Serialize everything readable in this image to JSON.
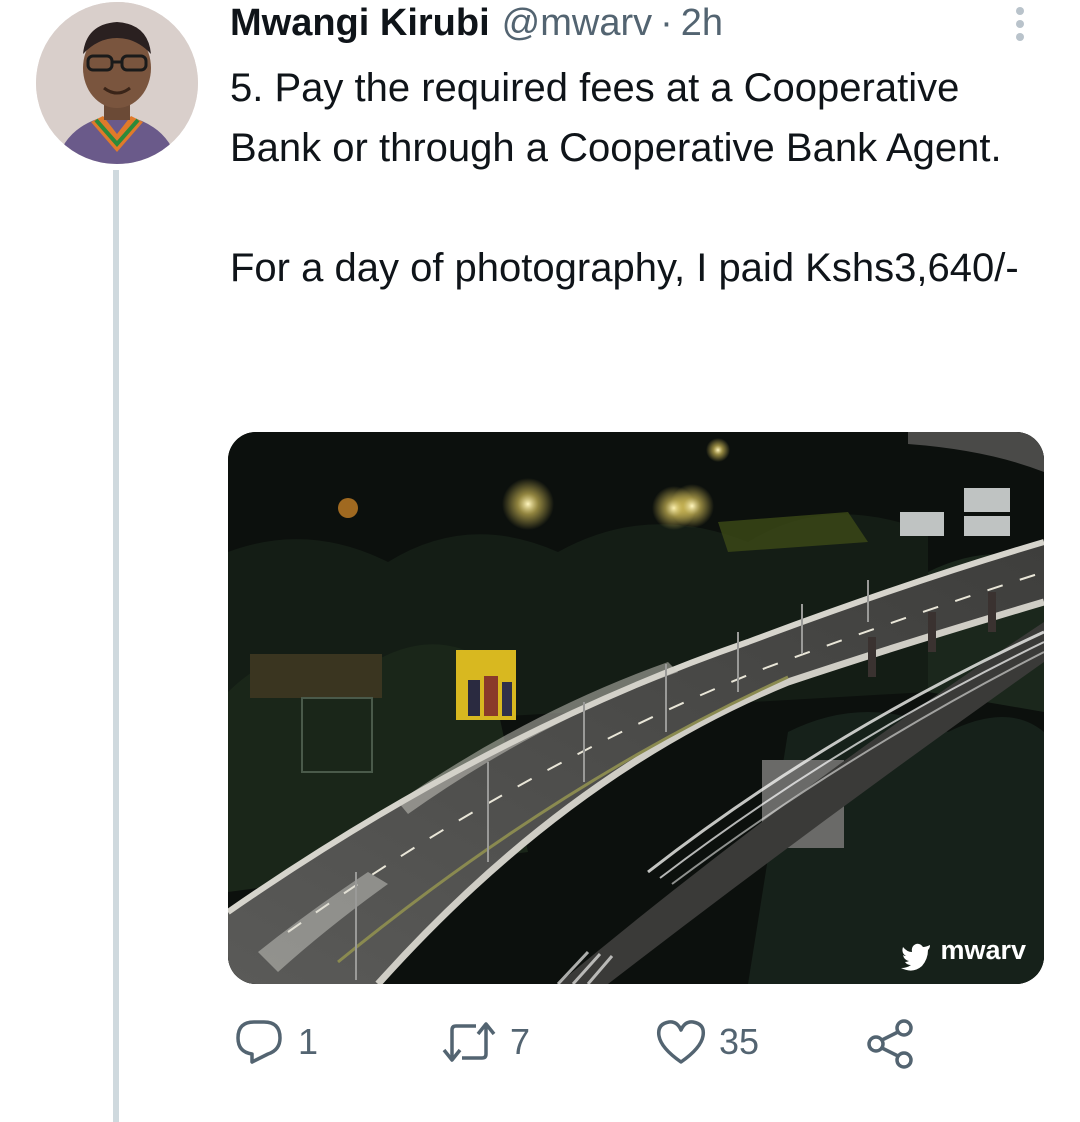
{
  "tweet": {
    "author_name": "Mwangi Kirubi",
    "author_handle": "@mwarv",
    "separator": "·",
    "time": "2h",
    "text": "5. Pay the required fees at a Cooperative Bank or through a Cooperative Bank Agent.\n\nFor a day of photography, I paid Kshs3,640/-",
    "media_watermark": "mwarv",
    "billboard_text": ""
  },
  "actions": {
    "reply_count": "1",
    "retweet_count": "7",
    "like_count": "35"
  },
  "colors": {
    "text_primary": "#0f1419",
    "text_secondary": "#536471",
    "thread_line": "#cfd9de"
  },
  "icons": {
    "reply": "reply-icon",
    "retweet": "retweet-icon",
    "like": "heart-icon",
    "share": "share-icon",
    "more": "more-options-icon"
  }
}
